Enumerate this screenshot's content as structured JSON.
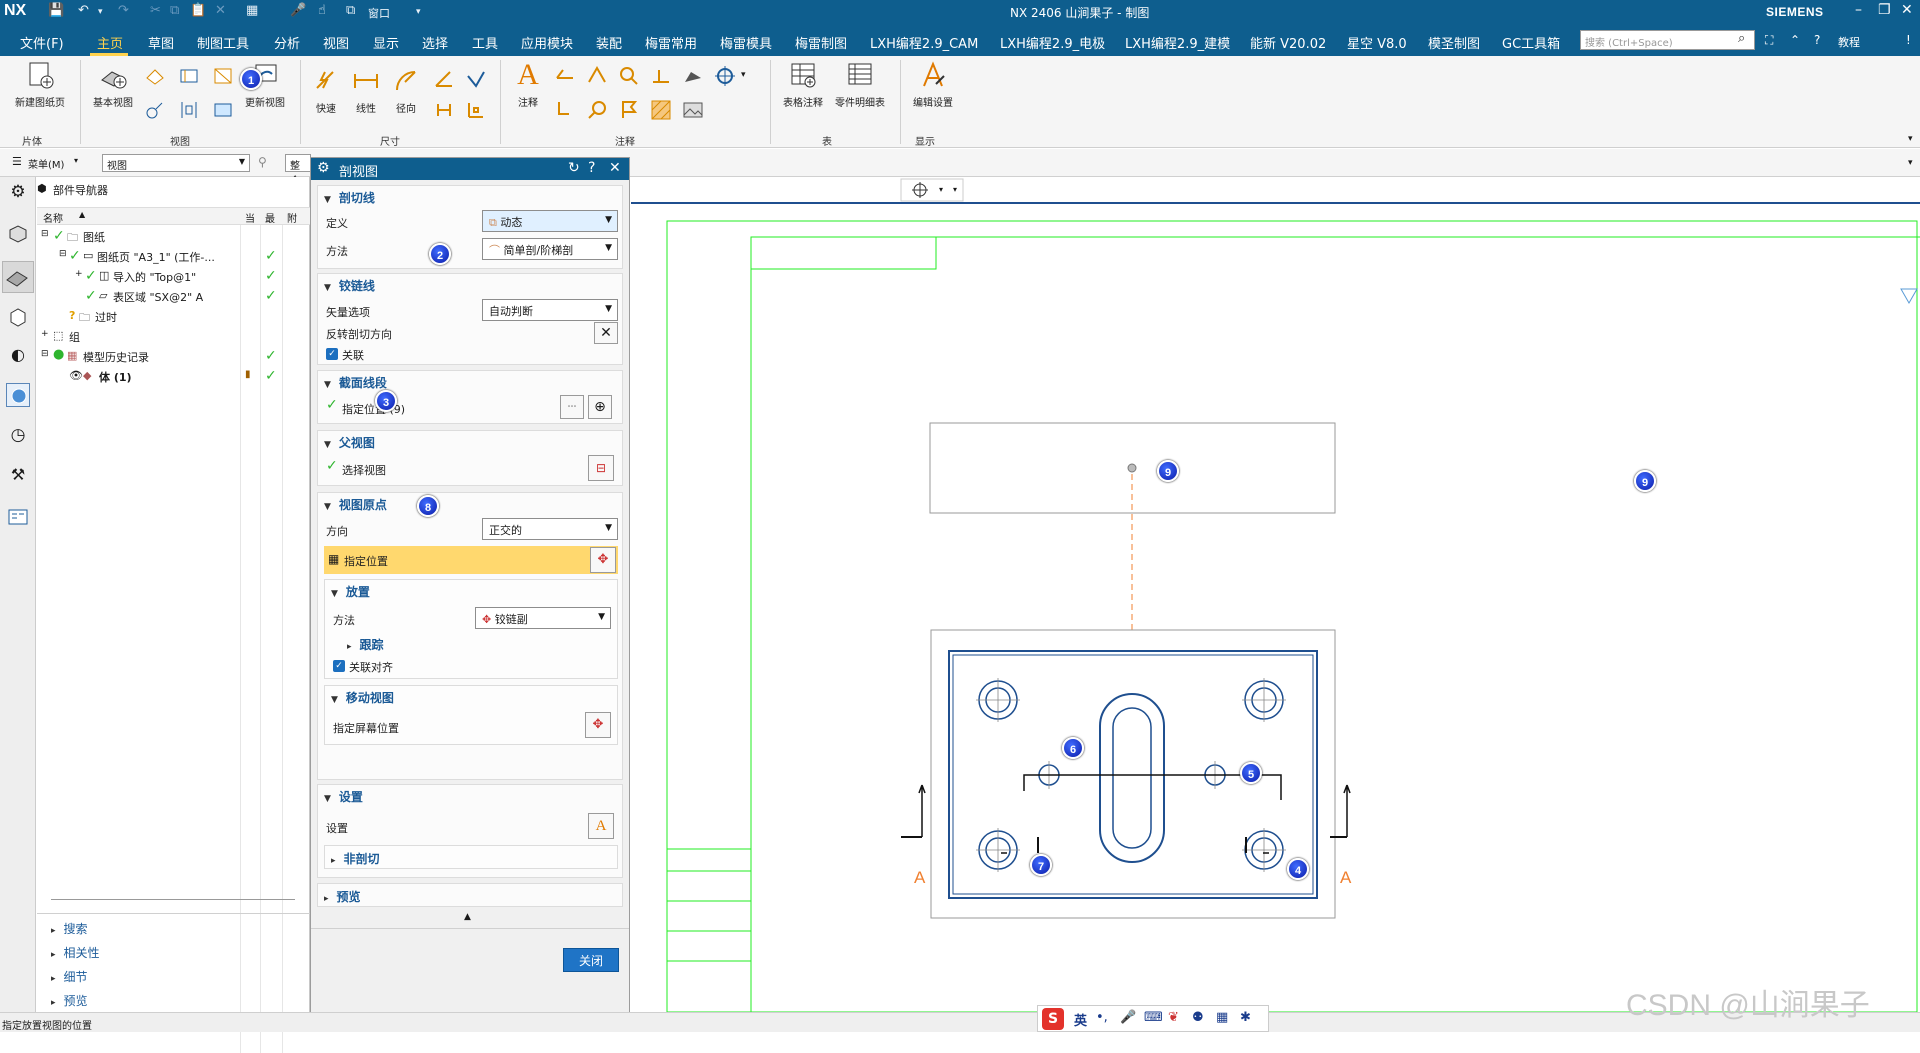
{
  "titlebar": {
    "logo": "NX",
    "window_title": "NX 2406 山涧果子 - 制图",
    "window_menu": "窗口",
    "brand": "SIEMENS"
  },
  "menubar": {
    "file": "文件(F)",
    "items": [
      "主页",
      "草图",
      "制图工具",
      "分析",
      "视图",
      "显示",
      "选择",
      "工具",
      "应用模块",
      "装配",
      "梅雷常用",
      "梅雷模具",
      "梅雷制图",
      "LXH编程2.9_CAM",
      "LXH编程2.9_电极",
      "LXH编程2.9_建模",
      "能新 V20.02",
      "星空 V8.0",
      "模圣制图",
      "GC工具箱"
    ],
    "search_placeholder": "搜索 (Ctrl+Space)",
    "tutorial": "教程"
  },
  "ribbon": {
    "new_sheet": "新建图纸页",
    "base_view": "基本视图",
    "update_view": "更新视图",
    "quick": "快速",
    "linear": "线性",
    "radial": "径向",
    "note": "注释",
    "table_note": "表格注释",
    "parts_list": "零件明细表",
    "edit_settings": "编辑设置",
    "groups": {
      "sheet": "片体",
      "view": "视图",
      "dimension": "尺寸",
      "annotation": "注释",
      "table": "表",
      "display": "显示"
    }
  },
  "toolrow": {
    "menu": "菜单(M)",
    "filter": "视图",
    "scope": "整个"
  },
  "navigator": {
    "title": "部件导航器",
    "columns": {
      "name": "名称",
      "current": "当",
      "latest": "最",
      "attached": "附"
    },
    "rows": [
      {
        "label": "图纸",
        "checked": true
      },
      {
        "label": "图纸页 \"A3_1\" (工作-...",
        "checked": true
      },
      {
        "label": "导入的 \"Top@1\"",
        "checked": true
      },
      {
        "label": "表区域 \"SX@2\" A",
        "checked": true
      },
      {
        "label": "过时",
        "checked": false
      },
      {
        "label": "组",
        "checked": false
      },
      {
        "label": "模型历史记录",
        "checked": true
      },
      {
        "label": "体 (1)",
        "checked": true
      }
    ],
    "links": [
      "搜索",
      "相关性",
      "细节",
      "预览"
    ]
  },
  "status": {
    "text": "指定放置视图的位置"
  },
  "dialog": {
    "title": "剖视图",
    "section_line": {
      "header": "剖切线",
      "define_label": "定义",
      "define_value": "动态",
      "method_label": "方法",
      "method_value": "简单剖/阶梯剖"
    },
    "hinge_line": {
      "header": "铰链线",
      "vector_label": "矢量选项",
      "vector_value": "自动判断",
      "reverse_label": "反转剖切方向",
      "associative_label": "关联"
    },
    "segments": {
      "header": "截面线段",
      "specify": "指定位置 (9)"
    },
    "parent_view": {
      "header": "父视图",
      "select": "选择视图"
    },
    "view_origin": {
      "header": "视图原点",
      "direction_label": "方向",
      "direction_value": "正交的",
      "specify": "指定位置",
      "placement_header": "放置",
      "method_label": "方法",
      "method_value": "铰链副",
      "tracking": "跟踪",
      "align": "关联对齐",
      "move_view_header": "移动视图",
      "screen_pos": "指定屏幕位置"
    },
    "settings": {
      "header": "设置",
      "label": "设置",
      "non_section": "非剖切"
    },
    "preview": {
      "header": "预览"
    },
    "close": "关闭"
  },
  "canvas": {
    "section_label": "A",
    "markers": [
      "1",
      "2",
      "3",
      "4",
      "5",
      "6",
      "7",
      "8",
      "9"
    ]
  },
  "ime": {
    "lang": "英"
  },
  "watermark": "CSDN @山涧果子",
  "colors": {
    "titlebar": "#0e5e8e",
    "accent": "#ffd24d",
    "border_green": "#22ee22",
    "section_orange": "#f08030",
    "view_blue": "#1f4f8f"
  }
}
